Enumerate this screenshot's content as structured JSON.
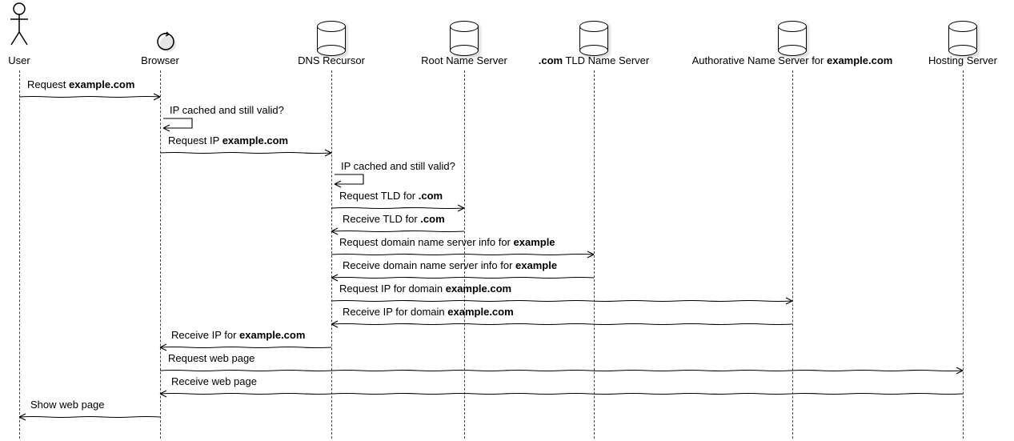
{
  "participants": {
    "user": {
      "label_plain": "User",
      "label_bold": ""
    },
    "browser": {
      "label_plain": "Browser",
      "label_bold": ""
    },
    "recursor": {
      "label_plain": "DNS Recursor",
      "label_bold": ""
    },
    "root": {
      "label_plain": "Root Name Server",
      "label_bold": ""
    },
    "tld": {
      "label_bold": ".com",
      "label_plain_suffix": " TLD Name Server"
    },
    "auth": {
      "label_plain_prefix": "Authorative Name Server for ",
      "label_bold": "example.com"
    },
    "host": {
      "label_plain": "Hosting Server",
      "label_bold": ""
    }
  },
  "messages": {
    "m1": {
      "parts": [
        {
          "t": "Request ",
          "b": false
        },
        {
          "t": "example.com",
          "b": true
        }
      ]
    },
    "m2": {
      "parts": [
        {
          "t": "IP cached and still valid?",
          "b": false
        }
      ]
    },
    "m3": {
      "parts": [
        {
          "t": "Request IP ",
          "b": false
        },
        {
          "t": "example.com",
          "b": true
        }
      ]
    },
    "m4": {
      "parts": [
        {
          "t": "IP cached and still valid?",
          "b": false
        }
      ]
    },
    "m5": {
      "parts": [
        {
          "t": "Request TLD for ",
          "b": false
        },
        {
          "t": ".com",
          "b": true
        }
      ]
    },
    "m6": {
      "parts": [
        {
          "t": "Receive TLD for ",
          "b": false
        },
        {
          "t": ".com",
          "b": true
        }
      ]
    },
    "m7": {
      "parts": [
        {
          "t": "Request domain name server info for ",
          "b": false
        },
        {
          "t": "example",
          "b": true
        }
      ]
    },
    "m8": {
      "parts": [
        {
          "t": "Receive domain name server info for ",
          "b": false
        },
        {
          "t": "example",
          "b": true
        }
      ]
    },
    "m9": {
      "parts": [
        {
          "t": "Request IP for domain ",
          "b": false
        },
        {
          "t": "example.com",
          "b": true
        }
      ]
    },
    "m10": {
      "parts": [
        {
          "t": "Receive IP for domain ",
          "b": false
        },
        {
          "t": "example.com",
          "b": true
        }
      ]
    },
    "m11": {
      "parts": [
        {
          "t": "Receive IP for ",
          "b": false
        },
        {
          "t": "example.com",
          "b": true
        }
      ]
    },
    "m12": {
      "parts": [
        {
          "t": "Request web page",
          "b": false
        }
      ]
    },
    "m13": {
      "parts": [
        {
          "t": "Receive web page",
          "b": false
        }
      ]
    },
    "m14": {
      "parts": [
        {
          "t": "Show web page",
          "b": false
        }
      ]
    }
  }
}
